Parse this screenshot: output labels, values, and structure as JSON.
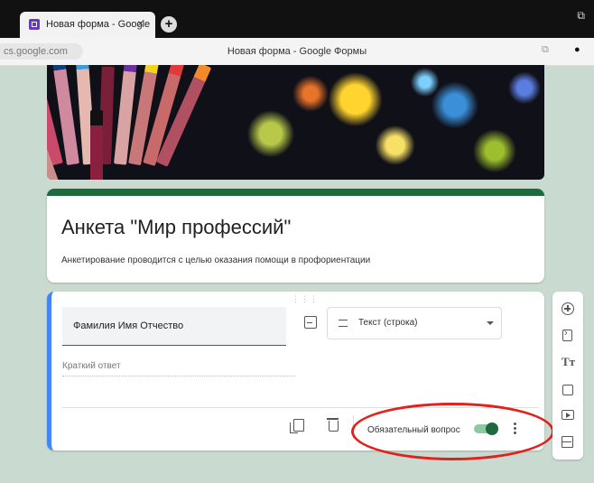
{
  "browser": {
    "tab_title": "Новая форма - Google",
    "tab_close": "×",
    "new_tab": "+",
    "url": "cs.google.com",
    "page_title": "Новая форма - Google Формы"
  },
  "form": {
    "title": "Анкета \"Мир профессий\"",
    "description": "Анкетирование проводится с целью оказания помощи в профориентации",
    "theme_color": "#1e6a3d"
  },
  "question": {
    "text": "Фамилия Имя Отчество",
    "type": "Текст (строка)",
    "answer_hint": "Краткий ответ",
    "required_label": "Обязательный вопрос",
    "required": true,
    "accent_color": "#4285f4"
  },
  "sidebar": {
    "title_tool": "Тт"
  },
  "annotation": {
    "highlight_color": "#e3211c"
  },
  "icons": [
    "plus-circle-icon",
    "import-icon",
    "title-icon",
    "image-icon",
    "video-icon",
    "section-icon",
    "copy-icon",
    "trash-icon",
    "more-vert-icon",
    "chevron-down-icon",
    "short-text-icon"
  ]
}
